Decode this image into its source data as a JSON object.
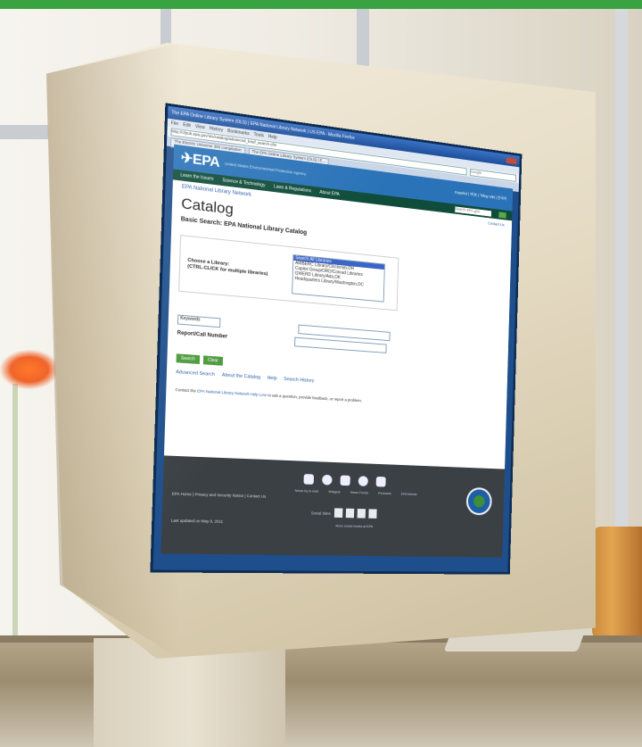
{
  "photo": {
    "top_band_color": "#3aa341",
    "flower_color": "#f0642a"
  },
  "browser": {
    "title": "The EPA Online Library System (OLS) | EPA National Library Network | US EPA - Mozilla Firefox",
    "menu": [
      "File",
      "Edit",
      "View",
      "History",
      "Bookmarks",
      "Tools",
      "Help"
    ],
    "address": "http://cfpub.epa.gov/ols/catalog/advanced_brief_search.cfm",
    "search_placeholder": "Google",
    "tabs": [
      "The Electric Universe 300 compilation",
      "The EPA Online Library System (OLS) | E..."
    ]
  },
  "site": {
    "logo": "✈EPA",
    "agency": "United States Environmental Protection Agency",
    "lang_links": "Español  |  中文  |  Tiếng Việt  |  한국어",
    "nav": [
      "Learn the Issues",
      "Science & Technology",
      "Laws & Regulations",
      "About EPA"
    ],
    "nav_search_placeholder": "Search EPA.gov",
    "network_link": "EPA National Library Network",
    "contact_us": "Contact Us",
    "page_title": "Catalog",
    "sub_title": "Basic Search: EPA National Library Catalog",
    "library_label": "Choose a Library:\n(CTRL-CLICK for multiple libraries)",
    "libraries": [
      "Search All Libraries",
      "AWBERC Library/Cincinnati,OH",
      "Capitol Group/ORD/Conrad Libraries",
      "GWERD Library/Ada,OK",
      "Headquarters Library/Washington,DC"
    ],
    "keyword_select": "Keywords",
    "report_label": "Report/Call Number",
    "search_button": "Search",
    "clear_button": "Clear",
    "links": [
      "Advanced Search",
      "About the Catalog",
      "Help",
      "Search History"
    ],
    "contact_prefix": "Contact the ",
    "contact_link": "EPA National Library Network Help Line",
    "contact_suffix": " to ask a question, provide feedback, or report a problem."
  },
  "footer": {
    "links": "EPA Home  |  Privacy and Security Notice  |  Contact Us",
    "updated": "Last updated on May 9, 2011",
    "icon_captions": [
      "News by E-mail",
      "Widgets",
      "News Feeds",
      "Podcasts",
      "EPA Mobile"
    ],
    "social_label": "Social Sites",
    "more_social": "More social media at EPA"
  }
}
